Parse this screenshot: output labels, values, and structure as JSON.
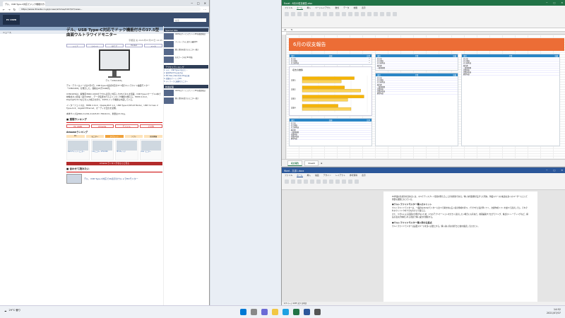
{
  "browser": {
    "tab_title": "デル、USB Type-C対応でドック機能付き…",
    "url": "https://www.itmedia.co.jp/pcuser/articles/2107/07/news...",
    "site_logo": "PC USER",
    "search_placeholder": "検索",
    "breadcrumb": "ニュース",
    "article": {
      "title": "デル、USB Type-C対応でドック機能付きの37.5型曲面ウルトラワイドモニター",
      "meta": "宇都宮 充 2021年07月07日 14:45",
      "share": [
        "シェア",
        "ツイート",
        "はてブ",
        "Pocket",
        "メール"
      ],
      "caption": "デル「U3821DW」",
      "para1": "デル・テクノロジーズは7月7日、USB Type-C接続対応の37.5型ウルトラワイド曲面モニター「U3821DW」を発売した。価格は20万5400円。",
      "para2": "U3821DWは、解像度3840×1600ピクセル表示に対応したIPSパネルを搭載。USB Type-Cケーブル1本で映像出力と給電（最大90W）、データ転送を行えるドッキング機能を備える。HDMI 2.0×2、DisplayPort×1などの入力端子を持ち、KVMスイッチ機能も内蔵している。",
      "para3": "インターフェイスは、HDMI 2.0×2、DisplayPort 1.4、USB Type-C(DP Alt Mode)、USB 3.2 Gen 2 Type-A×4、Gigabit Ethernet、オーディオ出力を装備。",
      "para4": "本体サイズは899.2×291.2×645.8〜780.6mm、重量は13.3kg。",
      "ranking_title": "■ 週間ランキング",
      "rank_buttons": [
        "PC USER",
        "ITmedia",
        "モバイル",
        "その他"
      ],
      "amazon_header": "Amazonランキング",
      "amazon_tabs": [
        "PC",
        "モニター",
        "タブレット",
        "ソフト",
        "周辺機器"
      ],
      "products": [
        "Dell 27インチ モニター",
        "LGモニター 27UL500",
        "HP 24インチ",
        "Acer モニター"
      ],
      "more_button": "Amazonランキングをもっと見る",
      "featured_title": "■ 合わせて読みたい",
      "featured_link": "デル、USB Type-C対応で4K表示のウルトラHDモニター"
    },
    "side": {
      "header1": "Special Site",
      "items": [
        "ASUSのゲーミングノートPCを徹底検証",
        "フレキシブルに使える最新PC",
        "働く環境を変えるモニター選び",
        "在宅ワーク向けPC特集"
      ],
      "header2": "アクセスランキング",
      "ranks": [
        "1. デル、USB Type-C対応で…",
        "2. 新型iPad Proの実力は",
        "3. M1 MacとWindows PCを比較",
        "4. 話題のゲーミングPC",
        "5. テレワークに最適なモニター"
      ],
      "header3": "新着記事"
    }
  },
  "excel": {
    "title": "Excel - 6月の収支報告.xlsx",
    "tabs": [
      "ファイル",
      "ホーム",
      "挿入",
      "ページレイアウト",
      "数式",
      "データ",
      "校閲",
      "表示"
    ],
    "active_tab": "ホーム",
    "cell_ref": "A1",
    "banner": "6月の収支報告",
    "chart_title": "収支の推移",
    "sheet_tabs": [
      "収支報告",
      "Sheet2"
    ],
    "table_header_left": [
      "項目",
      "金額",
      "比率"
    ],
    "table_header_right": [
      "項目",
      "予算",
      "実績"
    ],
    "rows": [
      "売上高",
      "売上原価",
      "売上総利益",
      "販売費",
      "一般管理費",
      "営業利益",
      "営業外収益",
      "経常利益"
    ]
  },
  "word": {
    "title": "Word - 文書1.docx",
    "tabs": [
      "ファイル",
      "ホーム",
      "挿入",
      "描画",
      "デザイン",
      "レイアウト",
      "参考資料",
      "表示"
    ],
    "active_tab": "ホーム",
    "p1": "PC作業の生産性を高めるには、マルチディスプレイ環境を整えることが効果的である。特に在宅勤務が広がった現在、作業スペースの拡張は多くのユーザーにとって重要な課題となっている。",
    "h1": "●ウルトラワイドモニター導入のメリット",
    "p2": "ウルトラワイドモニターは、一般的な16:9のモニターに比べて横方向に広い表示領域を持つ。ブラウザと表計算ソフト、文書作成ソフトを並べて表示しても、それぞれのウィンドウを十分な大きさで扱える。",
    "p3": "また、ベゼルによる画面の分断がないため、1つのアプリケーションを大きく表示したい場合にも有効だ。動画編集やプログラミング、株式のトレーディングなど、横長の表示が求められる用途で特に威力を発揮する。",
    "h2": "●ウルトラワイドモニター導入時の注意点",
    "p4": "ウルトラワイドモニターは設置スペースを多く必要とする。購入前に机の奥行きと幅を確認しておきたい。",
    "status": "1/3 ページ  1245 文字  日本語"
  },
  "taskbar": {
    "weather": "29°C 曇り",
    "time": "14:52",
    "date": "2021/07/07"
  },
  "colors": {
    "excel_green": "#217346",
    "word_blue": "#2b579a",
    "banner_orange": "#ec6d36"
  },
  "chart_data": {
    "type": "bar",
    "orientation": "horizontal",
    "title": "収支の推移",
    "categories": [
      "項目1",
      "項目2",
      "項目3",
      "項目4"
    ],
    "series": [
      {
        "name": "実績",
        "values": [
          80,
          65,
          95,
          55
        ]
      },
      {
        "name": "予算",
        "values": [
          60,
          90,
          70,
          75
        ]
      }
    ],
    "xlim": [
      0,
      100
    ],
    "grid": true,
    "legend": "top"
  }
}
